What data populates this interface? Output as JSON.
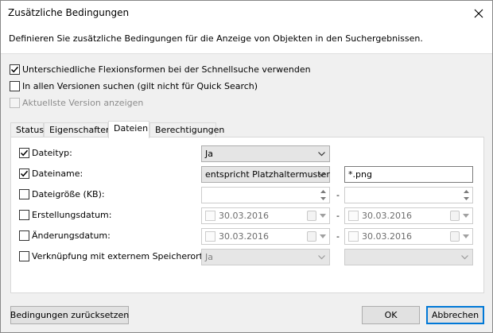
{
  "window": {
    "title": "Zusätzliche Bedingungen"
  },
  "description": "Definieren Sie zusätzliche Bedingungen für die Anzeige von Objekten in den Suchergebnissen.",
  "options": [
    {
      "label": "Unterschiedliche Flexionsformen bei der Schnellsuche verwenden",
      "checked": true,
      "enabled": true
    },
    {
      "label": "In allen Versionen suchen (gilt nicht für Quick Search)",
      "checked": false,
      "enabled": true
    },
    {
      "label": "Aktuellste Version anzeigen",
      "checked": false,
      "enabled": false
    }
  ],
  "tabs": [
    "Status",
    "Eigenschaften",
    "Dateien",
    "Berechtigungen"
  ],
  "active_tab": "Dateien",
  "conditions": {
    "dateityp": {
      "label": "Dateityp:",
      "checked": true,
      "value": "Ja"
    },
    "dateiname": {
      "label": "Dateiname:",
      "checked": true,
      "operator": "entspricht Platzhaltermuster",
      "value": "*.png"
    },
    "dateigroesse": {
      "label": "Dateigröße (KB):",
      "checked": false,
      "from": "",
      "separator": "-",
      "to": ""
    },
    "erstellungsdatum": {
      "label": "Erstellungsdatum:",
      "checked": false,
      "from": "30.03.2016",
      "separator": "-",
      "to": "30.03.2016"
    },
    "aenderungsdatum": {
      "label": "Änderungsdatum:",
      "checked": false,
      "from": "30.03.2016",
      "separator": "-",
      "to": "30.03.2016"
    },
    "verknuepfung": {
      "label": "Verknüpfung mit externem Speicherort:",
      "checked": false,
      "value": "Ja",
      "second": ""
    }
  },
  "buttons": {
    "reset": "Bedingungen zurücksetzen",
    "ok": "OK",
    "cancel": "Abbrechen"
  },
  "colors": {
    "accent": "#0078d7",
    "dialog_bg": "#f0f0f0",
    "check": "#000000"
  }
}
